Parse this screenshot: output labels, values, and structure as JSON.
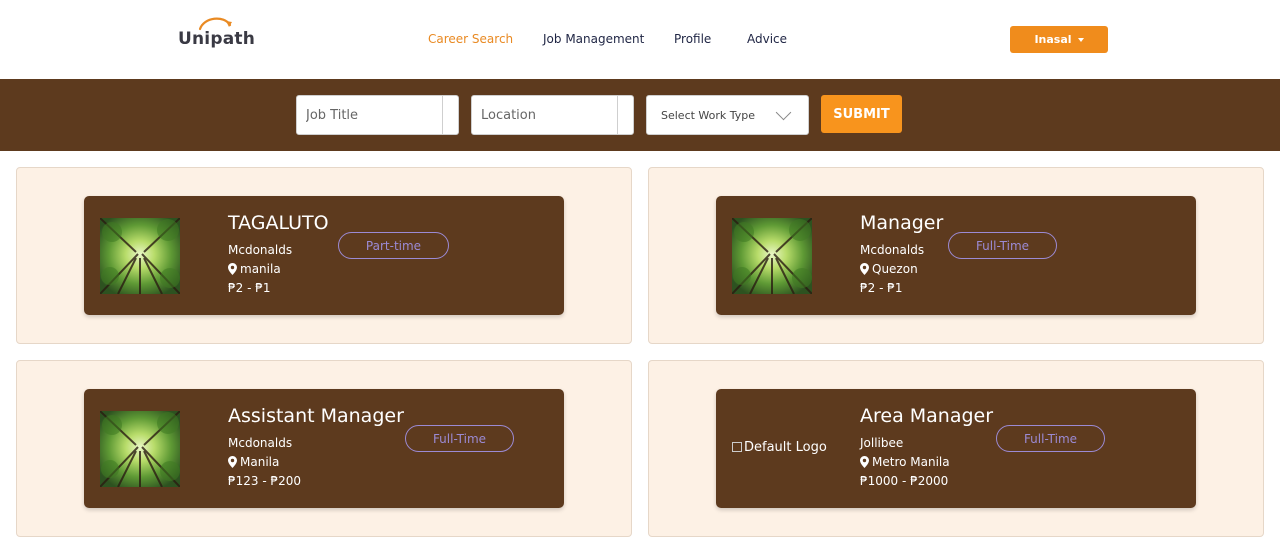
{
  "brand": {
    "name": "Unipath"
  },
  "nav": [
    {
      "label": "Career Search",
      "active": true
    },
    {
      "label": "Job Management",
      "active": false
    },
    {
      "label": "Profile",
      "active": false
    },
    {
      "label": "Advice",
      "active": false
    }
  ],
  "user": {
    "name": "Inasal"
  },
  "search": {
    "job_title_placeholder": "Job Title",
    "location_placeholder": "Location",
    "work_type_selected": "Select Work Type",
    "submit_label": "SUBMIT"
  },
  "colors": {
    "accent": "#f08c1c",
    "band": "#5d3a1e",
    "card_bg": "#fdf1e5",
    "badge": "#9b8ad4"
  },
  "jobs": [
    {
      "title": "TAGALUTO",
      "company": "Mcdonalds",
      "location": "manila",
      "salary": "₱2 - ₱1",
      "type": "Part-time",
      "image": "forest-canopy-photo"
    },
    {
      "title": "Manager",
      "company": "Mcdonalds",
      "location": "Quezon",
      "salary": "₱2 - ₱1",
      "type": "Full-Time",
      "image": "forest-canopy-photo"
    },
    {
      "title": "Assistant Manager",
      "company": "Mcdonalds",
      "location": "Manila",
      "salary": "₱123 - ₱200",
      "type": "Full-Time",
      "image": "forest-canopy-photo"
    },
    {
      "title": "Area Manager",
      "company": "Jollibee",
      "location": "Metro Manila",
      "salary": "₱1000 - ₱2000",
      "type": "Full-Time",
      "image_alt": "Default Logo"
    }
  ]
}
